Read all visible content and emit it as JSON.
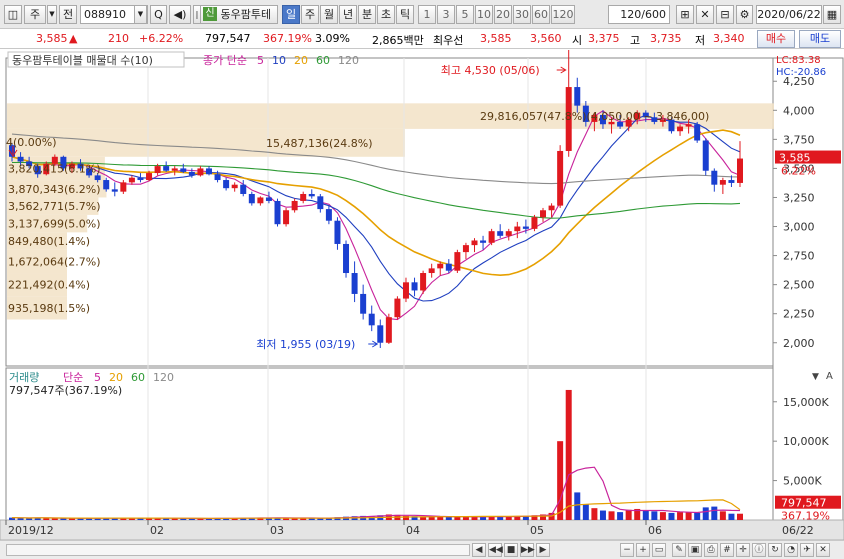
{
  "toolbar": {
    "type_label": "주",
    "market_label": "전",
    "code": "088910",
    "search_label": "Q",
    "sin_label": "신",
    "stock_name": "동우팜투테",
    "periods": [
      "일",
      "주",
      "월",
      "년",
      "분",
      "초",
      "틱"
    ],
    "selected_period": "일",
    "intervals": [
      "1",
      "3",
      "5",
      "10",
      "20",
      "30",
      "60",
      "120"
    ],
    "count": "120",
    "count_total": "/600",
    "date": "2020/06/22"
  },
  "quote": {
    "price": "3,585",
    "arrow": "▲",
    "change": "210",
    "change_pct": "+6.22%",
    "volume": "797,547",
    "volume_pct": "367.19%",
    "turnover_pct": "3.09%",
    "amount": "2,865백만",
    "best_ask_label": "최우선",
    "best_ask": "3,585",
    "best_bid": "3,560",
    "open_label": "시",
    "open": "3,375",
    "high_label": "고",
    "high": "3,735",
    "low_label": "저",
    "low": "3,340",
    "buy_label": "매수",
    "sell_label": "매도"
  },
  "price_panel": {
    "legend_name": "동우팜투테이블 매물대 수(10)",
    "legend_ma": "종가 단순",
    "ma_periods": [
      "5",
      "10",
      "20",
      "60",
      "120"
    ],
    "lc": "LC:83.38",
    "hc": "HC:-20.86",
    "max_marker": "최고 4,530 (05/06)",
    "min_marker": "최저 1,955 (03/19)",
    "current_price": "3,585",
    "current_pct": "6.22%",
    "zero_label": "4(0.00%)",
    "volume_profile": [
      {
        "label": "29,816,057(47.8%)(4,050.00 ~ 3,846.00)"
      },
      {
        "label": "15,487,136(24.8%)"
      },
      {
        "label": "3,820,415(6.1%)"
      },
      {
        "label": "3,870,343(6.2%)"
      },
      {
        "label": "3,562,771(5.7%)"
      },
      {
        "label": "3,137,699(5.0%)"
      },
      {
        "label": "849,480(1.4%)"
      },
      {
        "label": "1,672,064(2.7%)"
      },
      {
        "label": "221,492(0.4%)"
      },
      {
        "label": "935,198(1.5%)"
      }
    ],
    "y_ticks": [
      "4,250",
      "4,000",
      "3,750",
      "3,500",
      "3,250",
      "3,000",
      "2,750",
      "2,500",
      "2,250",
      "2,000"
    ]
  },
  "volume_panel": {
    "legend_name": "거래량",
    "legend_ma": "단순",
    "ma_periods": [
      "5",
      "20",
      "60",
      "120"
    ],
    "value_label": "797,547주(367.19%)",
    "current": "797,547",
    "current_pct": "367.19%",
    "y_ticks": [
      "15,000K",
      "10,000K",
      "5,000K"
    ]
  },
  "x_axis": {
    "labels": [
      "2019/12",
      "02",
      "03",
      "04",
      "05",
      "06"
    ],
    "right_label": "06/22"
  },
  "colors": {
    "up": "#e0191f",
    "down": "#1a3fd0",
    "ma5": "#c8239b",
    "ma10": "#1f3fc0",
    "ma20": "#e6a000",
    "ma60": "#2e9a35",
    "ma120": "#8a8a8a",
    "profile": "#f2e2c6"
  },
  "chart_data": {
    "type": "candlestick",
    "symbol": "088910",
    "period": "daily",
    "ylim": [
      1800,
      4450
    ],
    "candles": [
      [
        3700,
        3720,
        3560,
        3600
      ],
      [
        3600,
        3640,
        3520,
        3560
      ],
      [
        3560,
        3600,
        3500,
        3520
      ],
      [
        3520,
        3540,
        3420,
        3450
      ],
      [
        3450,
        3560,
        3440,
        3540
      ],
      [
        3540,
        3620,
        3520,
        3600
      ],
      [
        3600,
        3610,
        3480,
        3500
      ],
      [
        3500,
        3560,
        3460,
        3540
      ],
      [
        3540,
        3580,
        3480,
        3500
      ],
      [
        3500,
        3520,
        3420,
        3440
      ],
      [
        3440,
        3460,
        3380,
        3400
      ],
      [
        3400,
        3420,
        3300,
        3320
      ],
      [
        3320,
        3380,
        3260,
        3300
      ],
      [
        3300,
        3400,
        3280,
        3380
      ],
      [
        3380,
        3440,
        3360,
        3420
      ],
      [
        3420,
        3460,
        3380,
        3400
      ],
      [
        3400,
        3480,
        3390,
        3460
      ],
      [
        3460,
        3540,
        3440,
        3520
      ],
      [
        3520,
        3560,
        3470,
        3480
      ],
      [
        3480,
        3520,
        3440,
        3500
      ],
      [
        3500,
        3540,
        3460,
        3470
      ],
      [
        3470,
        3500,
        3420,
        3440
      ],
      [
        3440,
        3520,
        3430,
        3500
      ],
      [
        3500,
        3520,
        3440,
        3450
      ],
      [
        3450,
        3480,
        3380,
        3400
      ],
      [
        3400,
        3420,
        3310,
        3330
      ],
      [
        3330,
        3380,
        3300,
        3360
      ],
      [
        3360,
        3400,
        3260,
        3280
      ],
      [
        3280,
        3300,
        3180,
        3200
      ],
      [
        3200,
        3260,
        3180,
        3250
      ],
      [
        3250,
        3300,
        3200,
        3220
      ],
      [
        3220,
        3240,
        3000,
        3020
      ],
      [
        3020,
        3160,
        3000,
        3140
      ],
      [
        3140,
        3240,
        3120,
        3220
      ],
      [
        3220,
        3300,
        3200,
        3280
      ],
      [
        3280,
        3320,
        3240,
        3260
      ],
      [
        3260,
        3280,
        3120,
        3150
      ],
      [
        3150,
        3180,
        3020,
        3050
      ],
      [
        3050,
        3080,
        2800,
        2850
      ],
      [
        2850,
        2880,
        2560,
        2600
      ],
      [
        2600,
        2700,
        2350,
        2420
      ],
      [
        2420,
        2500,
        2200,
        2250
      ],
      [
        2250,
        2320,
        2100,
        2150
      ],
      [
        2150,
        2200,
        1955,
        2000
      ],
      [
        2000,
        2250,
        1990,
        2220
      ],
      [
        2220,
        2400,
        2200,
        2380
      ],
      [
        2380,
        2560,
        2350,
        2520
      ],
      [
        2520,
        2560,
        2400,
        2450
      ],
      [
        2450,
        2620,
        2420,
        2600
      ],
      [
        2600,
        2680,
        2560,
        2640
      ],
      [
        2640,
        2700,
        2580,
        2680
      ],
      [
        2680,
        2720,
        2600,
        2620
      ],
      [
        2620,
        2800,
        2600,
        2780
      ],
      [
        2780,
        2860,
        2720,
        2840
      ],
      [
        2840,
        2900,
        2780,
        2880
      ],
      [
        2880,
        2920,
        2800,
        2860
      ],
      [
        2860,
        2980,
        2840,
        2960
      ],
      [
        2960,
        3020,
        2900,
        2920
      ],
      [
        2920,
        2980,
        2880,
        2960
      ],
      [
        2960,
        3040,
        2900,
        3000
      ],
      [
        3000,
        3060,
        2940,
        2980
      ],
      [
        2980,
        3100,
        2960,
        3080
      ],
      [
        3080,
        3160,
        3040,
        3140
      ],
      [
        3140,
        3200,
        3080,
        3180
      ],
      [
        3180,
        3700,
        3160,
        3650
      ],
      [
        3650,
        4530,
        3600,
        4200
      ],
      [
        4200,
        4280,
        3980,
        4040
      ],
      [
        4040,
        4080,
        3860,
        3900
      ],
      [
        3900,
        3980,
        3820,
        3960
      ],
      [
        3960,
        4000,
        3840,
        3880
      ],
      [
        3880,
        3940,
        3800,
        3900
      ],
      [
        3900,
        3960,
        3840,
        3860
      ],
      [
        3860,
        3940,
        3820,
        3920
      ],
      [
        3920,
        4000,
        3880,
        3980
      ],
      [
        3980,
        4000,
        3900,
        3940
      ],
      [
        3940,
        3980,
        3880,
        3900
      ],
      [
        3900,
        3960,
        3860,
        3920
      ],
      [
        3920,
        3940,
        3800,
        3820
      ],
      [
        3820,
        3880,
        3780,
        3860
      ],
      [
        3860,
        3920,
        3800,
        3880
      ],
      [
        3880,
        3900,
        3720,
        3740
      ],
      [
        3740,
        3760,
        3440,
        3480
      ],
      [
        3480,
        3500,
        3300,
        3360
      ],
      [
        3360,
        3420,
        3280,
        3400
      ],
      [
        3400,
        3440,
        3340,
        3375
      ],
      [
        3375,
        3735,
        3340,
        3585
      ]
    ],
    "volume_k": [
      300,
      250,
      220,
      280,
      260,
      240,
      200,
      210,
      190,
      230,
      250,
      270,
      240,
      220,
      210,
      230,
      260,
      240,
      200,
      190,
      180,
      200,
      210,
      190,
      220,
      240,
      230,
      260,
      280,
      250,
      240,
      300,
      260,
      240,
      230,
      220,
      260,
      280,
      350,
      420,
      480,
      520,
      500,
      600,
      700,
      650,
      520,
      480,
      450,
      420,
      400,
      380,
      420,
      450,
      400,
      380,
      420,
      440,
      460,
      500,
      520,
      600,
      700,
      900,
      10000,
      16500,
      3500,
      2000,
      1500,
      1200,
      1100,
      1000,
      1300,
      1400,
      1200,
      1100,
      1000,
      900,
      1000,
      950,
      900,
      1600,
      1700,
      1100,
      800,
      797
    ]
  }
}
